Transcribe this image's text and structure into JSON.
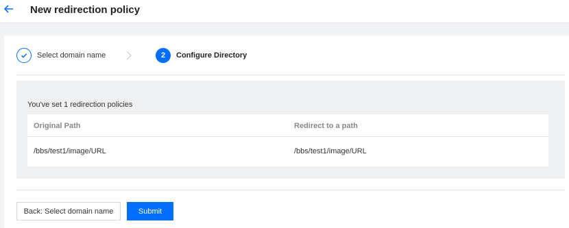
{
  "header": {
    "title": "New redirection policy",
    "back_icon": "arrow-left-icon"
  },
  "steps": [
    {
      "label": "Select domain name",
      "status": "completed",
      "icon": "check-icon"
    },
    {
      "number": "2",
      "label": "Configure Directory",
      "status": "active"
    }
  ],
  "step_separator_icon": "chevron-right-icon",
  "summary": {
    "text": "You've set 1 redirection policies",
    "table": {
      "headers": [
        "Original Path",
        "Redirect to a path"
      ],
      "rows": [
        [
          "/bbs/test1/image/URL",
          "/bbs/test1/image/URL"
        ]
      ]
    }
  },
  "actions": {
    "back_label": "Back: Select domain name",
    "submit_label": "Submit"
  },
  "colors": {
    "accent": "#006eff",
    "page_background": "#f2f3f5",
    "summary_background": "#eef0f2"
  }
}
